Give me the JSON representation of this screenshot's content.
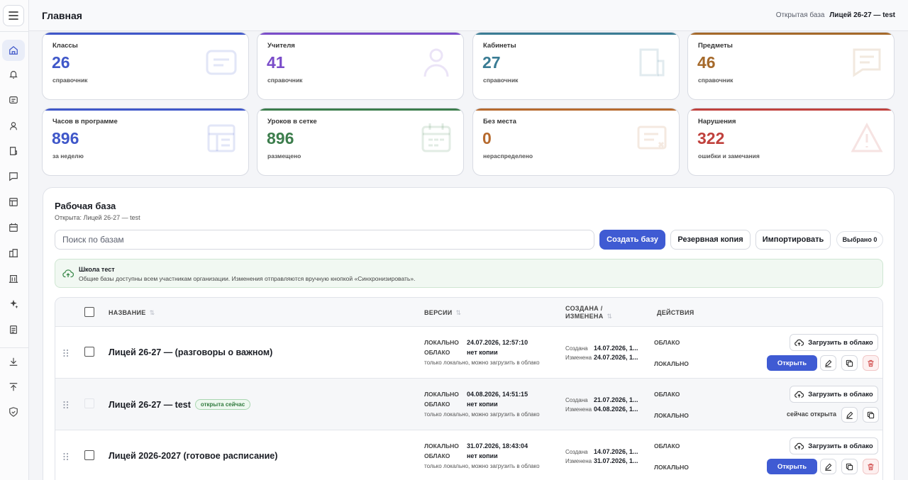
{
  "header": {
    "title": "Главная",
    "open_base_label": "Открытая база",
    "open_base_value": "Лицей 26-27 — test"
  },
  "sidebar": {
    "items": [
      "home-icon",
      "bell-icon",
      "message-square-icon",
      "user-icon",
      "door-icon",
      "chat-icon",
      "table-icon",
      "calendar-icon",
      "buildings-icon",
      "building-icon",
      "sparkles-icon",
      "document-icon",
      "download-icon",
      "upload-icon",
      "shield-icon"
    ]
  },
  "cards": [
    {
      "label": "Классы",
      "value": "26",
      "sub": "справочник",
      "color": "#3f57c9"
    },
    {
      "label": "Учителя",
      "value": "41",
      "sub": "справочник",
      "color": "#7a4cc9"
    },
    {
      "label": "Кабинеты",
      "value": "27",
      "sub": "справочник",
      "color": "#3a7c94"
    },
    {
      "label": "Предметы",
      "value": "46",
      "sub": "справочник",
      "color": "#a5692a"
    },
    {
      "label": "Часов в программе",
      "value": "896",
      "sub": "за неделю",
      "color": "#3f57c9"
    },
    {
      "label": "Уроков в сетке",
      "value": "896",
      "sub": "размещено",
      "color": "#3c7d4c"
    },
    {
      "label": "Без места",
      "value": "0",
      "sub": "нераспределено",
      "color": "#b66a2e"
    },
    {
      "label": "Нарушения",
      "value": "322",
      "sub": "ошибки и замечания",
      "color": "#c0413d"
    }
  ],
  "panel": {
    "title": "Рабочая база",
    "subtitle": "Открыта: Лицей 26-27 — test",
    "search_placeholder": "Поиск по базам",
    "create_label": "Создать базу",
    "backup_label": "Резервная копия",
    "import_label": "Импортировать",
    "selected_label": "Выбрано 0",
    "notice_title": "Школа тест",
    "notice_text": "Общие базы доступны всем участникам организации. Изменения отправляются вручную кнопкой «Синхронизировать»."
  },
  "table": {
    "col_name": "НАЗВАНИЕ",
    "col_versions": "ВЕРСИИ",
    "col_created_1": "СОЗДАНА /",
    "col_created_2": "ИЗМЕНЕНА",
    "col_actions": "ДЕЙСТВИЯ",
    "local_label": "ЛОКАЛЬНО",
    "cloud_label": "ОБЛАКО",
    "created_label": "Создана",
    "changed_label": "Изменена",
    "upload_label": "Загрузить в облако",
    "open_label": "Открыть",
    "now_open_label": "сейчас открыта",
    "rows": [
      {
        "name": "Лицей 26-27 — (разговоры о важном)",
        "badge": "",
        "local": "24.07.2026, 12:57:10",
        "cloud": "нет копии",
        "note": "только локально, можно загрузить в облако",
        "created": "14.07.2026, 1...",
        "changed": "24.07.2026, 1..."
      },
      {
        "name": "Лицей 26-27 — test",
        "badge": "открыта сейчас",
        "local": "04.08.2026, 14:51:15",
        "cloud": "нет копии",
        "note": "только локально, можно загрузить в облако",
        "created": "21.07.2026, 1...",
        "changed": "04.08.2026, 1..."
      },
      {
        "name": "Лицей 2026-2027 (готовое расписание)",
        "badge": "",
        "local": "31.07.2026, 18:43:04",
        "cloud": "нет копии",
        "note": "только локально, можно загрузить в облако",
        "created": "14.07.2026, 1...",
        "changed": "31.07.2026, 1..."
      }
    ]
  }
}
